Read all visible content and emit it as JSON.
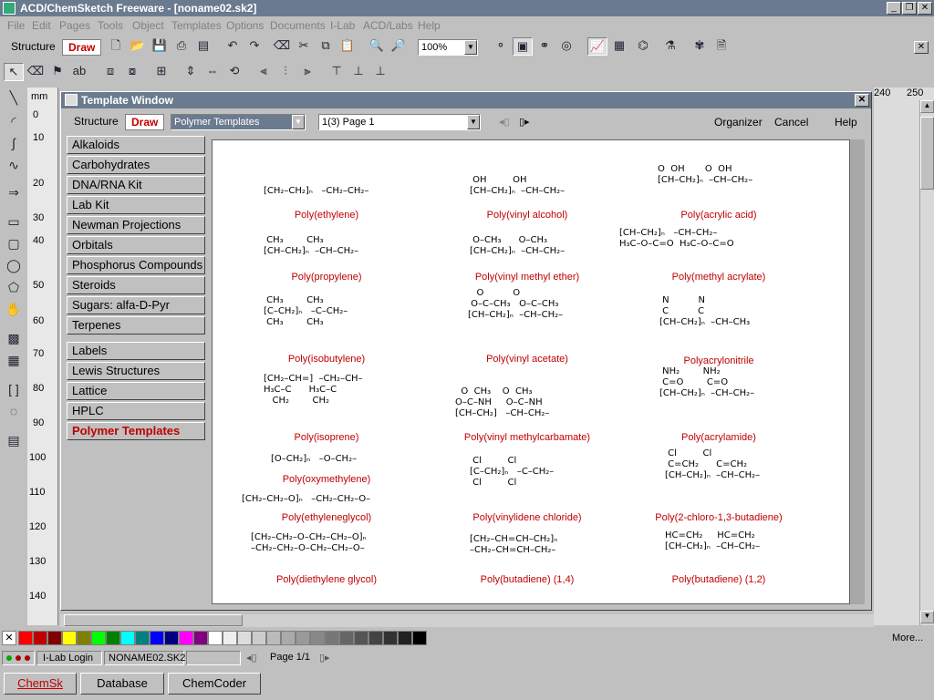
{
  "window": {
    "title": "ACD/ChemSketch Freeware - [noname02.sk2]"
  },
  "menu": [
    "File",
    "Edit",
    "Pages",
    "Tools",
    "Object",
    "Templates",
    "Options",
    "Documents",
    "I-Lab",
    "ACD/Labs",
    "Help"
  ],
  "toolbar": {
    "structure_label": "Structure",
    "draw_label": "Draw",
    "zoom": "100%"
  },
  "ruler": {
    "unit": "mm",
    "ticks": [
      "0",
      "10",
      "20",
      "30",
      "40",
      "50",
      "60",
      "70",
      "80",
      "90",
      "100",
      "110",
      "120",
      "130",
      "140"
    ],
    "top_right": [
      "240",
      "250"
    ]
  },
  "template_window": {
    "title": "Template Window",
    "structure_label": "Structure",
    "draw_label": "Draw",
    "category_select": "Polymer Templates",
    "page_select": "1(3) Page 1",
    "organizer_label": "Organizer",
    "cancel_label": "Cancel",
    "help_label": "Help",
    "categories_top": [
      "Alkaloids",
      "Carbohydrates",
      "DNA/RNA Kit",
      "Lab Kit",
      "Newman Projections",
      "Orbitals",
      "Phosphorus Compounds",
      "Steroids",
      "Sugars: alfa-D-Pyr",
      "Terpenes"
    ],
    "categories_bottom": [
      "Labels",
      "Lewis Structures",
      "Lattice",
      "HPLC",
      "Polymer Templates"
    ],
    "active_category": "Polymer Templates"
  },
  "polymers": [
    {
      "name": "Poly(ethylene)",
      "formula": "[CH₂–CH₂]ₙ   –CH₂–CH₂–"
    },
    {
      "name": "Poly(vinyl alcohol)",
      "formula": " OH         OH\n[CH–CH₂]ₙ  –CH–CH₂–"
    },
    {
      "name": "Poly(acrylic acid)",
      "formula": "O  OH       O  OH\n[CH–CH₂]ₙ  –CH–CH₂–"
    },
    {
      "name": "Poly(propylene)",
      "formula": " CH₃        CH₃\n[CH–CH₂]ₙ  –CH–CH₂–"
    },
    {
      "name": "Poly(vinyl methyl ether)",
      "formula": " O–CH₃      O–CH₃\n[CH–CH₂]ₙ  –CH–CH₂–"
    },
    {
      "name": "Poly(methyl acrylate)",
      "formula": "[CH–CH₂]ₙ   –CH–CH₂–\nH₃C–O–C=O  H₃C–O–C=O"
    },
    {
      "name": "Poly(isobutylene)",
      "formula": " CH₃        CH₃\n[C–CH₂]ₙ   –C–CH₂–\n CH₃        CH₃"
    },
    {
      "name": "Poly(vinyl acetate)",
      "formula": "   O          O\n O–C–CH₃   O–C–CH₃\n[CH–CH₂]ₙ  –CH–CH₂–"
    },
    {
      "name": "Polyacrylonitrile",
      "formula": " N          N\n C          C\n[CH–CH₂]ₙ  –CH–CH₃"
    },
    {
      "name": "Poly(isoprene)",
      "formula": "[CH₂–CH=]  –CH₂–CH–\nH₃C–C      H₃C–C\n   CH₂        CH₂"
    },
    {
      "name": "Poly(vinyl methylcarbamate)",
      "formula": "  O  CH₃    O  CH₃\nO–C–NH     O–C–NH\n[CH–CH₂]   –CH–CH₂–"
    },
    {
      "name": "Poly(acrylamide)",
      "formula": " NH₂        NH₂\n C=O        C=O\n[CH–CH₂]ₙ  –CH–CH₂–"
    },
    {
      "name": "Poly(oxymethylene)",
      "formula": "[O–CH₂]ₙ   –O–CH₂–"
    },
    {
      "name": "Poly(vinylidene chloride)",
      "formula": " Cl         Cl\n[C–CH₂]ₙ   –C–CH₂–\n Cl         Cl"
    },
    {
      "name": "Poly(2-chloro-1,3-butadiene)",
      "formula": " Cl         Cl\n C=CH₂      C=CH₂\n[CH–CH₂]ₙ  –CH–CH₂–"
    },
    {
      "name": "Poly(ethyleneglycol)",
      "formula": "[CH₂–CH₂–O]ₙ   –CH₂–CH₂–O–"
    },
    {
      "name": "Poly(diethylene glycol)",
      "formula": "[CH₂–CH₂–O–CH₂–CH₂–O]ₙ\n–CH₂–CH₂–O–CH₂–CH₂–O–"
    },
    {
      "name": "Poly(butadiene) (1,4)",
      "formula": "[CH₂–CH=CH–CH₂]ₙ\n–CH₂–CH=CH–CH₂–"
    },
    {
      "name": "Poly(butadiene) (1,2)",
      "formula": "HC=CH₂     HC=CH₂\n[CH–CH₂]ₙ  –CH–CH₂–"
    }
  ],
  "palette_colors": [
    "#ff0000",
    "#c00000",
    "#800000",
    "#ffff00",
    "#808000",
    "#00ff00",
    "#008000",
    "#00ffff",
    "#008080",
    "#0000ff",
    "#000080",
    "#ff00ff",
    "#800080",
    "#ffffff",
    "#eeeeee",
    "#dddddd",
    "#cccccc",
    "#bbbbbb",
    "#aaaaaa",
    "#999999",
    "#888888",
    "#777777",
    "#666666",
    "#555555",
    "#444444",
    "#333333",
    "#222222",
    "#000000"
  ],
  "palette_more": "More...",
  "status": {
    "ilab": "I-Lab Login",
    "doc": "NONAME02.SK2",
    "page": "Page 1/1"
  },
  "taskbar": [
    "ChemSk",
    "Database",
    "ChemCoder"
  ]
}
